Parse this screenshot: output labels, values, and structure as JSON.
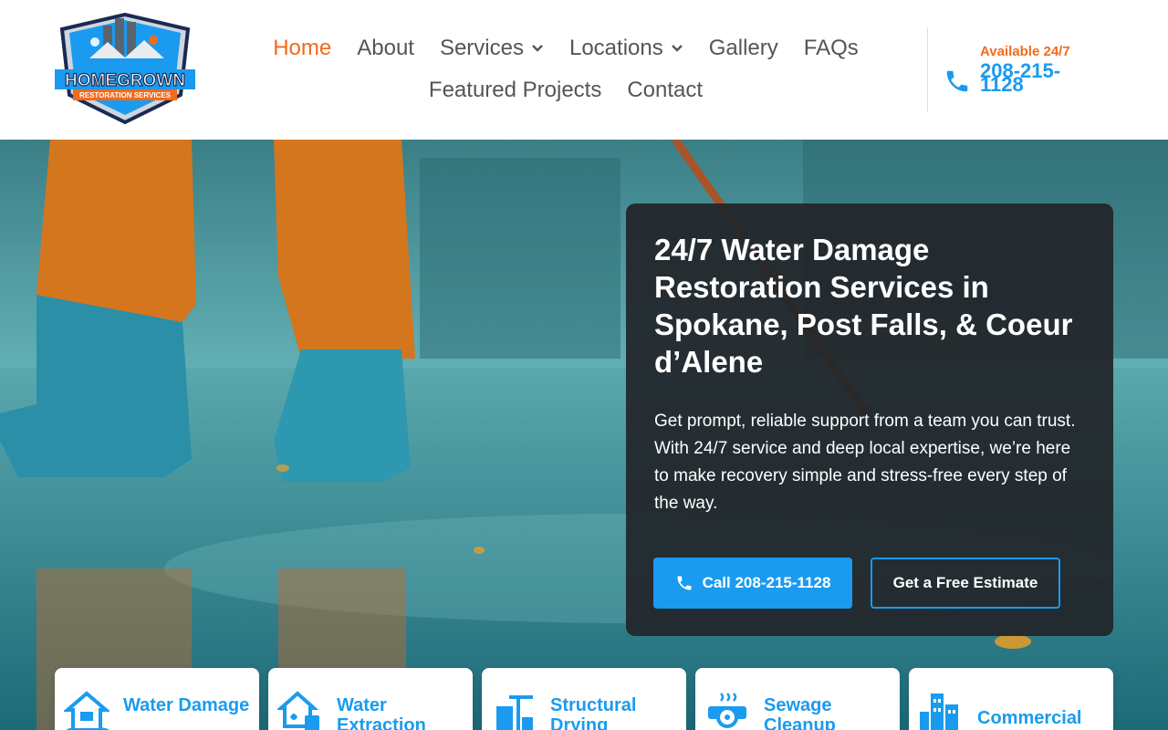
{
  "logo": {
    "brand": "HOMEGROWN",
    "tagline": "RESTORATION SERVICES"
  },
  "nav": {
    "row1": [
      {
        "label": "Home",
        "active": true,
        "dropdown": false
      },
      {
        "label": "About",
        "active": false,
        "dropdown": false
      },
      {
        "label": "Services",
        "active": false,
        "dropdown": true
      },
      {
        "label": "Locations",
        "active": false,
        "dropdown": true
      },
      {
        "label": "Gallery",
        "active": false,
        "dropdown": false
      },
      {
        "label": "FAQs",
        "active": false,
        "dropdown": false
      }
    ],
    "row2": [
      {
        "label": "Featured Projects"
      },
      {
        "label": "Contact"
      }
    ]
  },
  "header_contact": {
    "available": "Available 24/7",
    "phone": "208-215-1128"
  },
  "hero": {
    "title": "24/7 Water Damage Restoration Services in Spokane, Post Falls, & Coeur d’Alene",
    "text": "Get prompt, reliable support from a team you can trust. With 24/7 service and deep local expertise, we’re here to make recovery simple and stress-free every step of the way.",
    "call_button": "Call 208-215-1128",
    "estimate_button": "Get a Free Estimate"
  },
  "services": [
    {
      "label": "Water Damage",
      "icon": "house-water-icon"
    },
    {
      "label": "Water Extraction",
      "icon": "water-extraction-icon"
    },
    {
      "label": "Structural Drying",
      "icon": "structural-drying-icon"
    },
    {
      "label": "Sewage Cleanup",
      "icon": "sewage-pipe-icon"
    },
    {
      "label": "Commercial",
      "icon": "commercial-building-icon"
    }
  ],
  "colors": {
    "accent": "#1a9bf0",
    "active_nav": "#f26a1b",
    "card_bg": "#212529"
  }
}
